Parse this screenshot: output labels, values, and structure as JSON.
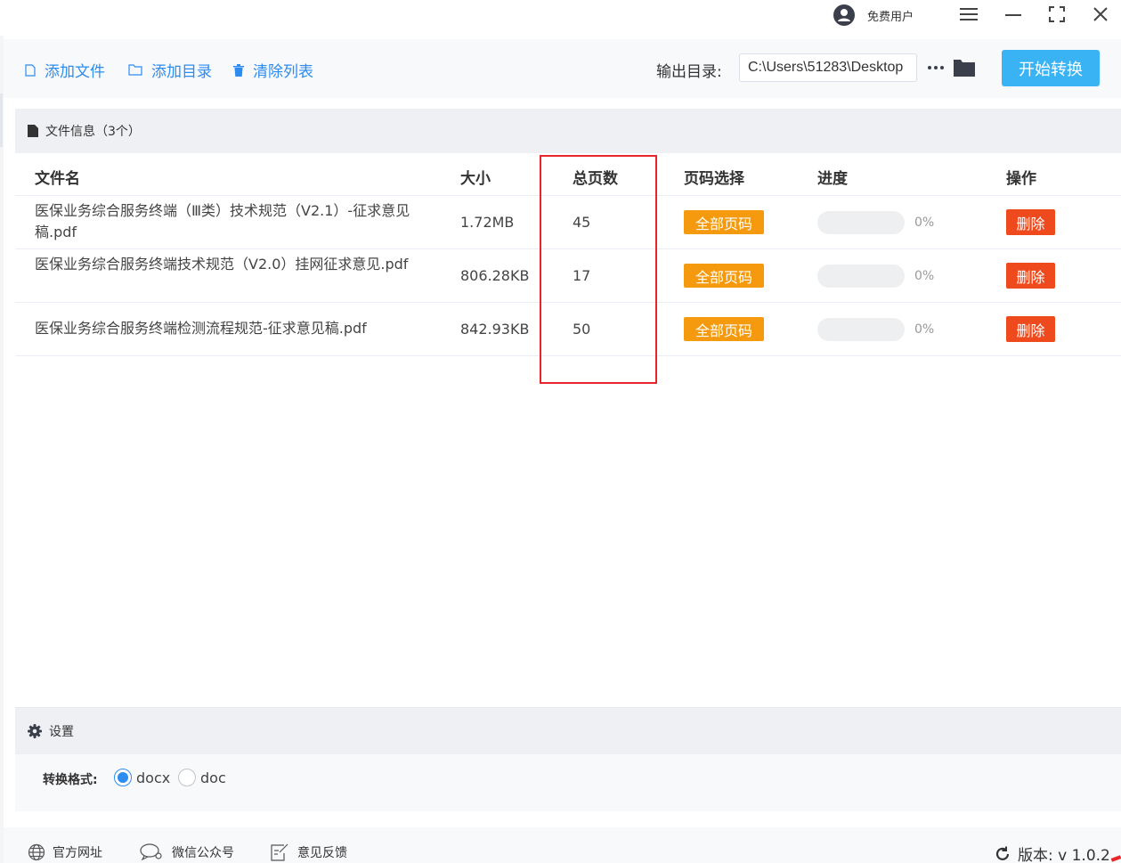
{
  "titlebar": {
    "user_name": "免费用户"
  },
  "toolbar": {
    "add_file": "添加文件",
    "add_dir": "添加目录",
    "clear_list": "清除列表",
    "output_label": "输出目录:",
    "output_path": "C:\\Users\\51283\\Desktop",
    "start_button": "开始转换"
  },
  "file_panel": {
    "title": "文件信息（3个）",
    "columns": {
      "name": "文件名",
      "size": "大小",
      "pages": "总页数",
      "page_select": "页码选择",
      "progress": "进度",
      "action": "操作"
    },
    "rows": [
      {
        "name": "医保业务综合服务终端（Ⅲ类）技术规范（V2.1）-征求意见稿.pdf",
        "size": "1.72MB",
        "pages": "45",
        "page_select": "全部页码",
        "progress": 0,
        "progress_text": "0%",
        "action": "删除"
      },
      {
        "name": "医保业务综合服务终端技术规范（V2.0）挂网征求意见.pdf",
        "size": "806.28KB",
        "pages": "17",
        "page_select": "全部页码",
        "progress": 0,
        "progress_text": "0%",
        "action": "删除"
      },
      {
        "name": "医保业务综合服务终端检测流程规范-征求意见稿.pdf",
        "size": "842.93KB",
        "pages": "50",
        "page_select": "全部页码",
        "progress": 0,
        "progress_text": "0%",
        "action": "删除"
      }
    ]
  },
  "settings": {
    "title": "设置",
    "format_label": "转换格式:",
    "options": [
      "docx",
      "doc"
    ],
    "selected": "docx"
  },
  "footer": {
    "website": "官方网址",
    "wechat": "微信公众号",
    "feedback": "意见反馈",
    "version": "版本: v 1.0.2"
  },
  "colors": {
    "accent": "#2d8cf0",
    "start_button": "#3ab3f5",
    "page_badge": "#f59a0f",
    "delete_button": "#ee4a1d",
    "highlight": "#e6262a"
  }
}
